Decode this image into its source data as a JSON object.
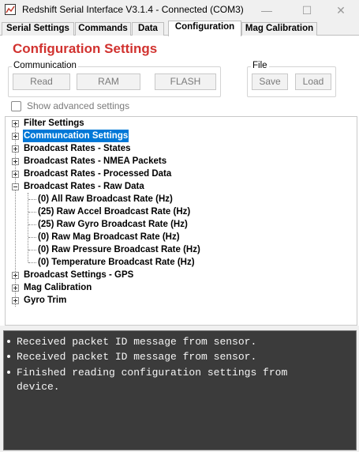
{
  "window": {
    "title": "Redshift Serial Interface V3.1.4 - Connected (COM3)",
    "controls": {
      "minimize_icon": "minimize-icon",
      "maximize_icon": "maximize-icon",
      "close_icon": "close-icon"
    }
  },
  "tabs": [
    {
      "label": "Serial Settings",
      "active": false
    },
    {
      "label": "Commands",
      "active": false
    },
    {
      "label": "Data",
      "active": false
    },
    {
      "label": "Configuration",
      "active": true
    },
    {
      "label": "Mag Calibration",
      "active": false
    }
  ],
  "config": {
    "title": "Configuration Settings",
    "title_color": "#d1322f",
    "communication": {
      "label": "Communication",
      "buttons": {
        "read": "Read",
        "ram": "RAM",
        "flash": "FLASH"
      }
    },
    "file": {
      "label": "File",
      "buttons": {
        "save": "Save",
        "load": "Load"
      }
    },
    "advanced": {
      "label": "Show advanced settings",
      "checked": false
    }
  },
  "tree": {
    "items": [
      {
        "label": "Filter Settings",
        "expanded": false,
        "selected": false
      },
      {
        "label": "Communcation Settings",
        "expanded": false,
        "selected": true
      },
      {
        "label": "Broadcast Rates - States",
        "expanded": false,
        "selected": false
      },
      {
        "label": "Broadcast Rates - NMEA Packets",
        "expanded": false,
        "selected": false
      },
      {
        "label": "Broadcast Rates - Processed Data",
        "expanded": false,
        "selected": false
      },
      {
        "label": "Broadcast Rates - Raw Data",
        "expanded": true,
        "selected": false,
        "children": [
          "(0) All Raw Broadcast Rate (Hz)",
          "(25) Raw Accel Broadcast Rate (Hz)",
          "(25) Raw Gyro Broadcast Rate (Hz)",
          "(0) Raw Mag Broadcast Rate (Hz)",
          "(0) Raw Pressure Broadcast Rate (Hz)",
          "(0) Temperature Broadcast Rate (Hz)"
        ]
      },
      {
        "label": "Broadcast Settings - GPS",
        "expanded": false,
        "selected": false
      },
      {
        "label": "Mag Calibration",
        "expanded": false,
        "selected": false
      },
      {
        "label": "Gyro Trim",
        "expanded": false,
        "selected": false
      }
    ],
    "selection_color": "#0078d7"
  },
  "console": {
    "background": "#3b3b3b",
    "lines": [
      "Received packet ID message from sensor.",
      "Received packet ID message from sensor.",
      "Finished reading configuration settings from",
      "device."
    ]
  }
}
